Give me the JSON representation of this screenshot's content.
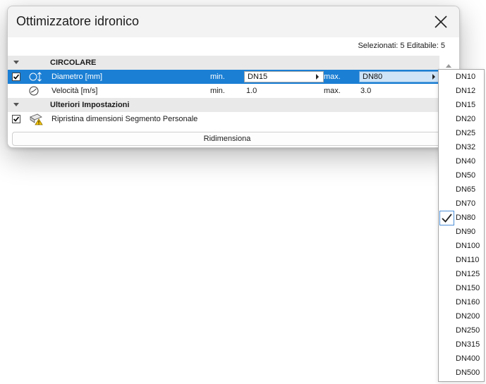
{
  "dialog": {
    "title": "Ottimizzatore idronico",
    "status": "Selezionati: 5 Editabile: 5",
    "sections": {
      "circular": "CIRCOLARE",
      "further": "Ulteriori Impostazioni"
    },
    "rows": {
      "diameter": {
        "label": "Diametro [mm]",
        "min_label": "min.",
        "min_value": "DN15",
        "max_label": "max.",
        "max_value": "DN80",
        "checked": true
      },
      "speed": {
        "label": "Velocità [m/s]",
        "min_label": "min.",
        "min_value": "1.0",
        "max_label": "max.",
        "max_value": "3.0"
      },
      "restore": {
        "label": "Ripristina dimensioni Segmento Personale",
        "checked": true
      }
    },
    "resize_button": "Ridimensiona"
  },
  "dropdown": {
    "selected": "DN80",
    "options": [
      "DN10",
      "DN12",
      "DN15",
      "DN20",
      "DN25",
      "DN32",
      "DN40",
      "DN50",
      "DN65",
      "DN70",
      "DN80",
      "DN90",
      "DN100",
      "DN110",
      "DN125",
      "DN150",
      "DN160",
      "DN200",
      "DN250",
      "DN315",
      "DN400",
      "DN500"
    ]
  },
  "colors": {
    "selection": "#1b7fd4",
    "check_border": "#4c8fd6",
    "header_bg": "#e9e9e9"
  }
}
